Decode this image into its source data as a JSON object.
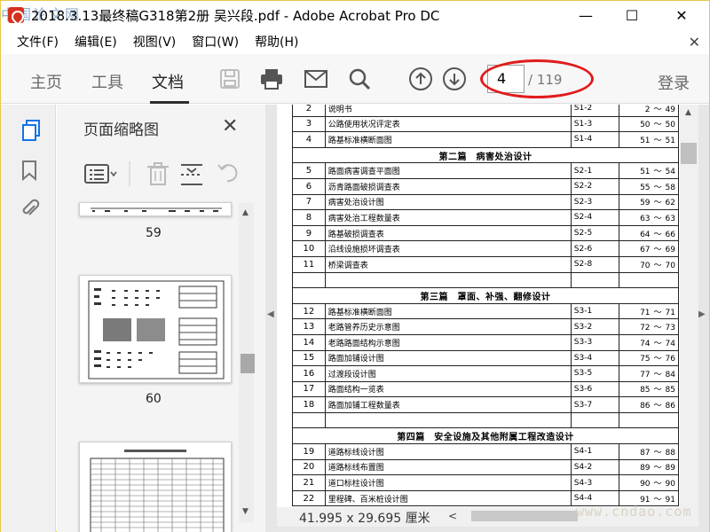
{
  "window": {
    "title": "2018.3.13最终稿G318第2册 吴兴段.pdf - Adobe Acrobat Pro DC",
    "minimize": "—",
    "maximize": "☐",
    "close": "✕",
    "watermark_tl": "中国论文网"
  },
  "menu": {
    "items": [
      "文件(F)",
      "编辑(E)",
      "视图(V)",
      "窗口(W)",
      "帮助(H)"
    ],
    "close": "✕"
  },
  "toolbar": {
    "tabs": [
      "主页",
      "工具",
      "文档"
    ],
    "active_tab": "文档",
    "current_page": "4",
    "total_pages": "/ 119",
    "login": "登录"
  },
  "sidebar": {
    "panel_title": "页面缩略图",
    "close": "✕",
    "thumbnails": [
      {
        "label": "59"
      },
      {
        "label": "60"
      }
    ]
  },
  "document": {
    "rows": [
      {
        "num": "2",
        "name": "说明书",
        "code": "S1-2",
        "start": "2",
        "end": "49"
      },
      {
        "num": "3",
        "name": "公路使用状况评定表",
        "code": "S1-3",
        "start": "50",
        "end": "50"
      },
      {
        "num": "4",
        "name": "路基标准横断面图",
        "code": "S1-4",
        "start": "51",
        "end": "51"
      },
      {
        "section": "第二篇　病害处治设计"
      },
      {
        "num": "5",
        "name": "路面病害调查平面图",
        "code": "S2-1",
        "start": "51",
        "end": "54"
      },
      {
        "num": "6",
        "name": "沥青路面破损调查表",
        "code": "S2-2",
        "start": "55",
        "end": "58"
      },
      {
        "num": "7",
        "name": "病害处治设计图",
        "code": "S2-3",
        "start": "59",
        "end": "62"
      },
      {
        "num": "8",
        "name": "病害处治工程数量表",
        "code": "S2-4",
        "start": "63",
        "end": "63"
      },
      {
        "num": "9",
        "name": "路基破损调查表",
        "code": "S2-5",
        "start": "64",
        "end": "66"
      },
      {
        "num": "10",
        "name": "沿线设施损坏调查表",
        "code": "S2-6",
        "start": "67",
        "end": "69"
      },
      {
        "num": "11",
        "name": "桥梁调查表",
        "code": "S2-8",
        "start": "70",
        "end": "70"
      },
      {
        "blank": true
      },
      {
        "section": "第三篇　罩面、补强、翻修设计"
      },
      {
        "num": "12",
        "name": "路基标准横断面图",
        "code": "S3-1",
        "start": "71",
        "end": "71"
      },
      {
        "num": "13",
        "name": "老路管养历史示意图",
        "code": "S3-2",
        "start": "72",
        "end": "73"
      },
      {
        "num": "14",
        "name": "老路路面结构示意图",
        "code": "S3-3",
        "start": "74",
        "end": "74"
      },
      {
        "num": "15",
        "name": "路面加铺设计图",
        "code": "S3-4",
        "start": "75",
        "end": "76"
      },
      {
        "num": "16",
        "name": "过渡段设计图",
        "code": "S3-5",
        "start": "77",
        "end": "84"
      },
      {
        "num": "17",
        "name": "路面结构一览表",
        "code": "S3-6",
        "start": "85",
        "end": "85"
      },
      {
        "num": "18",
        "name": "路面加铺工程数量表",
        "code": "S3-7",
        "start": "86",
        "end": "86"
      },
      {
        "blank": true
      },
      {
        "section": "第四篇　安全设施及其他附属工程改造设计"
      },
      {
        "num": "19",
        "name": "道路标线设计图",
        "code": "S4-1",
        "start": "87",
        "end": "88"
      },
      {
        "num": "20",
        "name": "道路标线布置图",
        "code": "S4-2",
        "start": "89",
        "end": "89"
      },
      {
        "num": "21",
        "name": "道口标柱设计图",
        "code": "S4-3",
        "start": "90",
        "end": "90"
      },
      {
        "num": "22",
        "name": "里程碑、百米桩设计图",
        "code": "S4-4",
        "start": "91",
        "end": "91"
      }
    ],
    "range_sep": "～"
  },
  "status": {
    "dimensions": "41.995 x 29.695 厘米",
    "watermark_br": "www.cndao.com"
  }
}
